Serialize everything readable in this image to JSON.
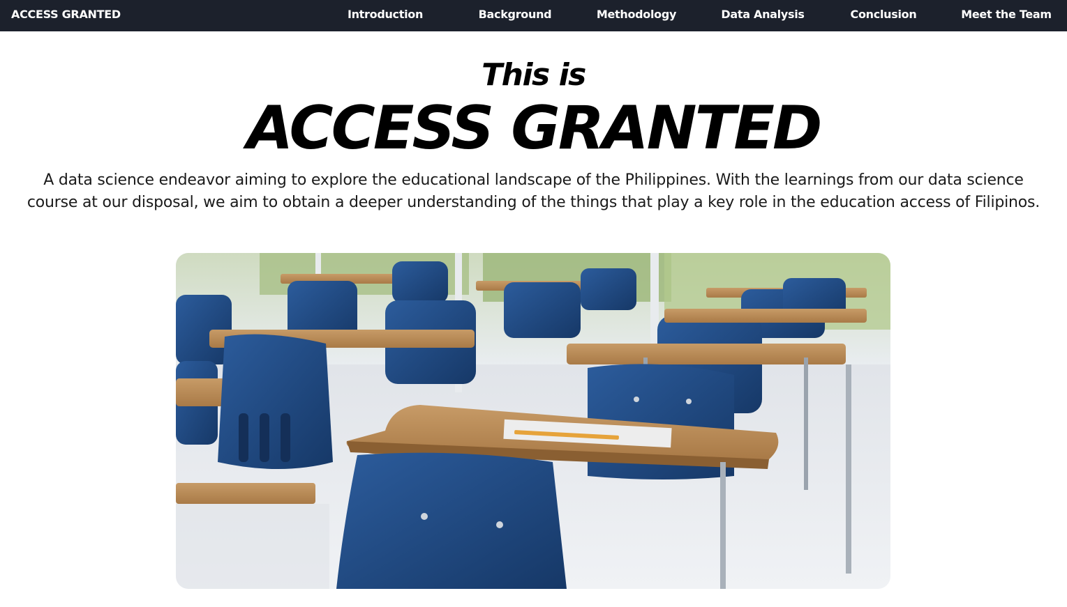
{
  "navbar": {
    "brand": "ACCESS GRANTED",
    "links": [
      {
        "label": "Introduction"
      },
      {
        "label": "Background"
      },
      {
        "label": "Methodology"
      },
      {
        "label": "Data Analysis"
      },
      {
        "label": "Conclusion"
      },
      {
        "label": "Meet the Team"
      }
    ]
  },
  "hero": {
    "pretitle": "This is",
    "title": "ACCESS GRANTED",
    "description": "A data science endeavor aiming to explore the educational landscape of the Philippines. With the learnings from our data science course at our disposal, we aim to obtain a deeper understanding of the things that play a key role in the education access of Filipinos.",
    "image_subject": "classroom-desks-photo"
  },
  "colors": {
    "navbar_bg": "#1c212c",
    "navbar_text": "#ffffff",
    "page_bg": "#ffffff",
    "chair_blue": "#1f4a86",
    "desk_wood": "#b98a57"
  }
}
